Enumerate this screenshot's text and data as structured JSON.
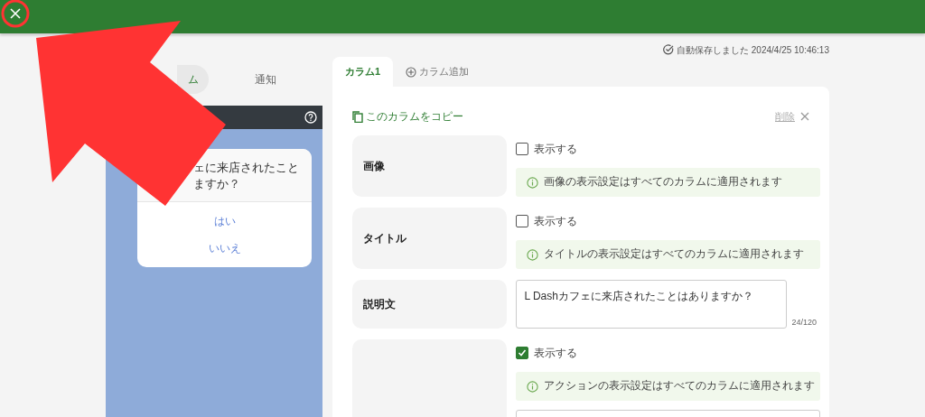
{
  "autosave": "自動保存しました 2024/4/25 10:46:13",
  "preview_tabs": [
    {
      "label": "ム",
      "selected": true
    },
    {
      "label": "通知",
      "selected": false
    }
  ],
  "preview": {
    "message_lines": [
      "ェに来店されたこと",
      "ますか？"
    ],
    "actions": [
      "はい",
      "いいえ"
    ]
  },
  "column_tabs": [
    {
      "label": "カラム1",
      "selected": true,
      "kind": "tab"
    },
    {
      "label": "カラム追加",
      "selected": false,
      "kind": "add"
    }
  ],
  "copy_link": "このカラムをコピー",
  "delete": "削除",
  "fields": [
    {
      "label": "画像",
      "kind": "toggle",
      "option": "表示する",
      "checked": false,
      "note": "画像の表示設定はすべてのカラムに適用されます"
    },
    {
      "label": "タイトル",
      "kind": "toggle",
      "option": "表示する",
      "checked": false,
      "note": "タイトルの表示設定はすべてのカラムに適用されます"
    },
    {
      "label": "説明文",
      "kind": "text",
      "value": "L Dashカフェに来店されたことはありますか？",
      "counter": "24/120"
    },
    {
      "kind": "toggle",
      "option": "表示する",
      "checked": true,
      "note": "アクションの表示設定はすべてのカラムに適用されます"
    }
  ]
}
